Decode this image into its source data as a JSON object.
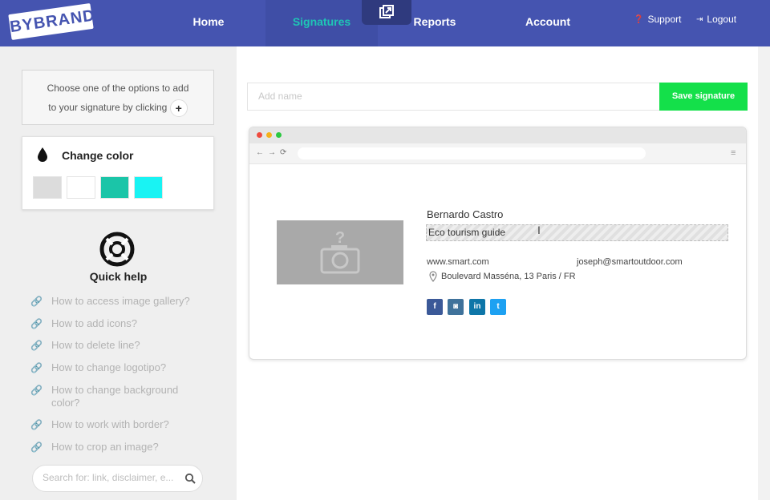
{
  "header": {
    "logo_text": "BYBRAND",
    "nav": [
      {
        "label": "Home",
        "active": false
      },
      {
        "label": "Signatures",
        "active": true
      },
      {
        "label": "Reports",
        "active": false
      },
      {
        "label": "Account",
        "active": false
      }
    ],
    "support_label": "Support",
    "logout_label": "Logout",
    "popout_icon": "popout-icon"
  },
  "sidebar": {
    "instruction_line1": "Choose one of the options to add",
    "instruction_line2": "to your signature by clicking",
    "plus_symbol": "+",
    "change_color_title": "Change color",
    "swatches": [
      "#dcdcdc",
      "#ffffff",
      "#1bc5a8",
      "#19f3f3"
    ],
    "quick_help_title": "Quick help",
    "help_items": [
      "How to access image gallery?",
      "How to add icons?",
      "How to delete line?",
      "How to change logotipo?",
      "How to change background color?",
      "How to work with border?",
      "How to crop an image?"
    ],
    "search_placeholder": "Search for: link, disclaimer, e..."
  },
  "editor": {
    "name_placeholder": "Add name",
    "save_label": "Save signature",
    "signature": {
      "image_placeholder_icon": "camera-question-icon",
      "name": "Bernardo Castro",
      "role": "Eco tourism guide",
      "website": "www.smart.com",
      "email": "joseph@smartoutdoor.com",
      "address": "Boulevard Masséna, 13 Paris / FR",
      "social": [
        {
          "icon": "facebook-icon",
          "glyph": "f",
          "color": "#3b5998"
        },
        {
          "icon": "instagram-icon",
          "glyph": "◙",
          "color": "#3f729b"
        },
        {
          "icon": "linkedin-icon",
          "glyph": "in",
          "color": "#0e76a8"
        },
        {
          "icon": "twitter-icon",
          "glyph": "t",
          "color": "#1da1f2"
        }
      ]
    }
  }
}
